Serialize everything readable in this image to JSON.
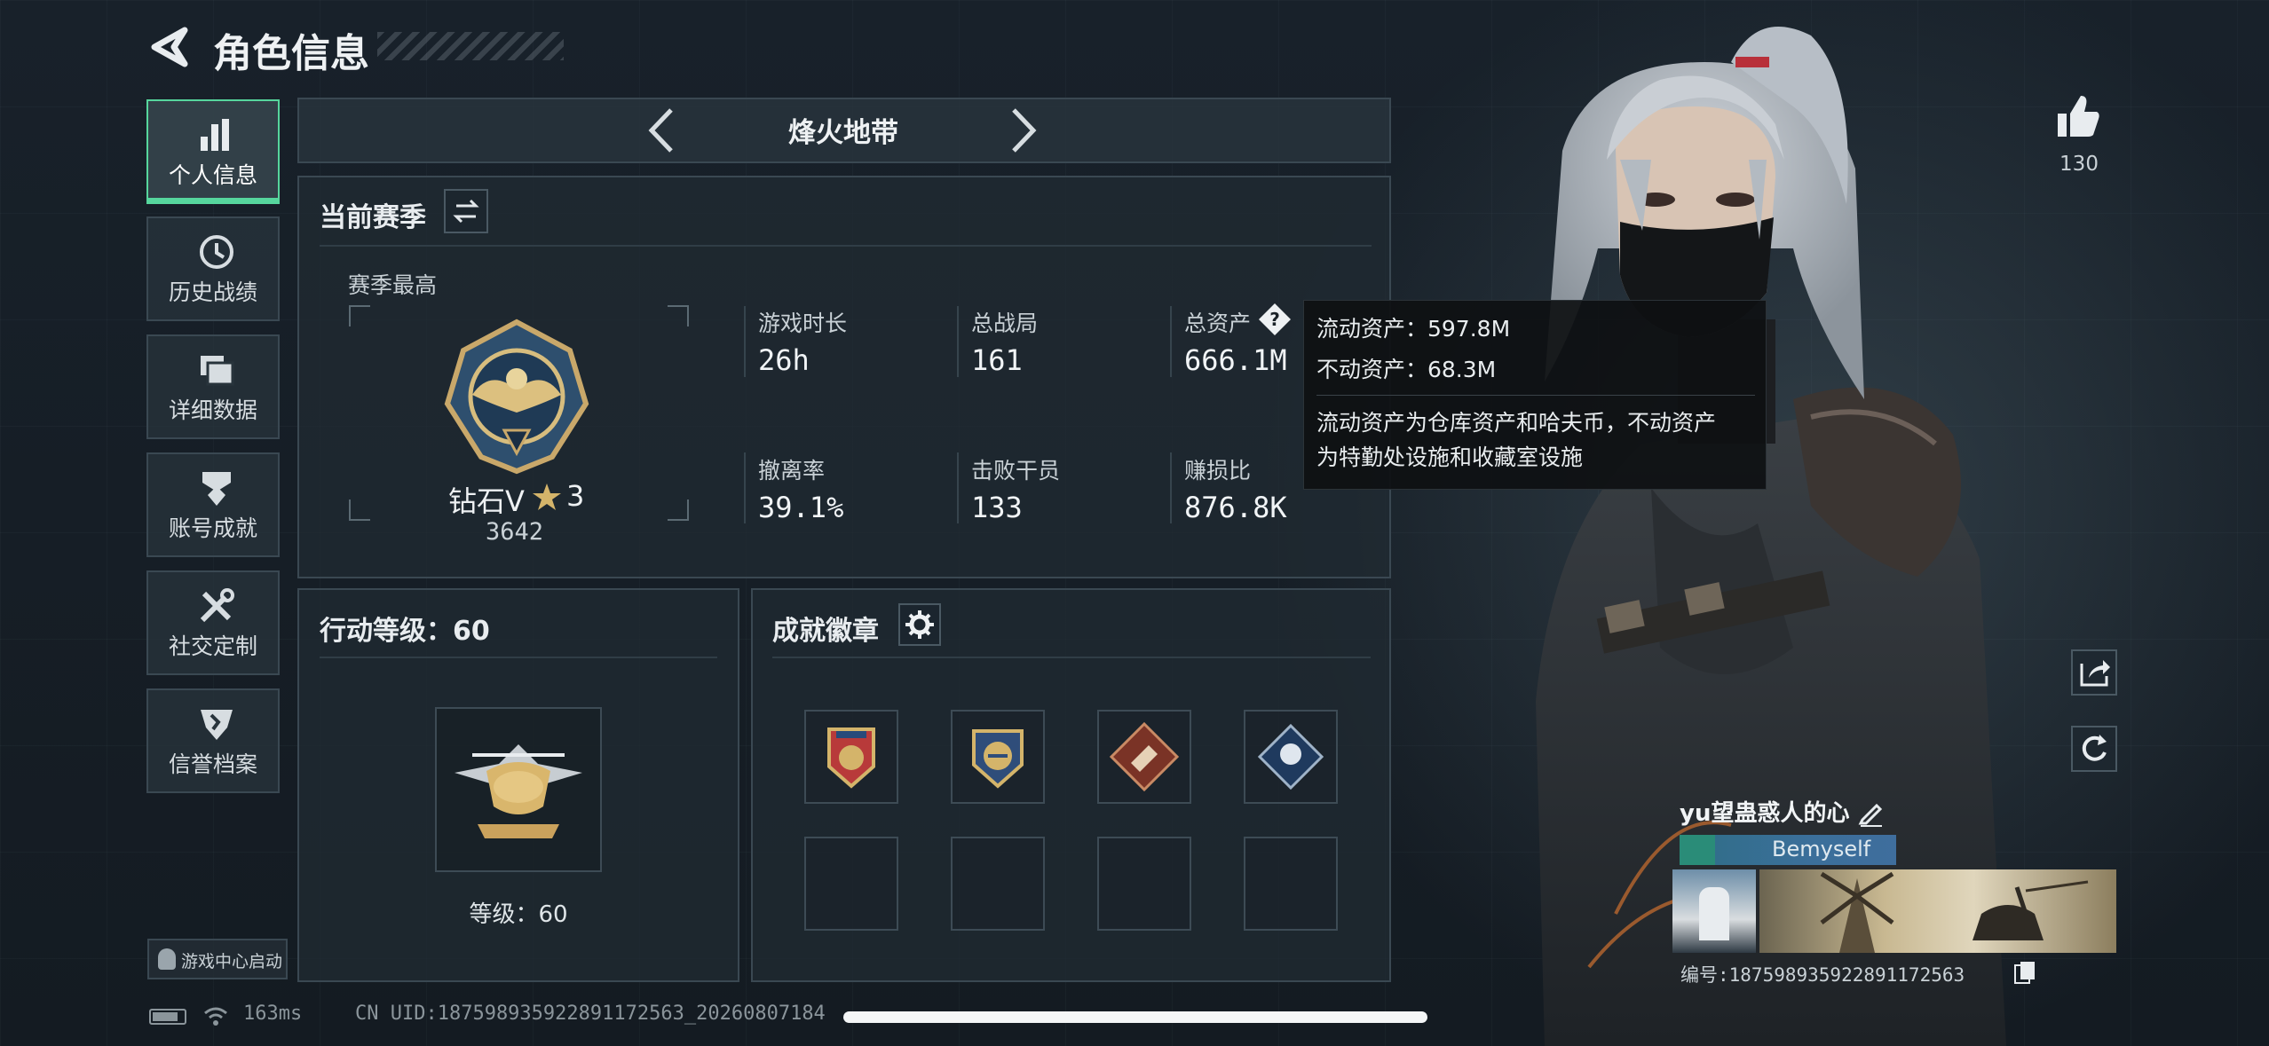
{
  "header": {
    "title": "角色信息"
  },
  "sidebar": {
    "items": [
      {
        "label": "个人信息",
        "icon": "bar-chart-icon",
        "active": true
      },
      {
        "label": "历史战绩",
        "icon": "clock-icon"
      },
      {
        "label": "详细数据",
        "icon": "folder-icon"
      },
      {
        "label": "账号成就",
        "icon": "achievement-icon"
      },
      {
        "label": "社交定制",
        "icon": "tools-icon"
      },
      {
        "label": "信誉档案",
        "icon": "shield-icon"
      }
    ],
    "game_center_label": "游戏中心启动"
  },
  "mode_selector": {
    "label": "烽火地带"
  },
  "season": {
    "title": "当前赛季",
    "best_label": "赛季最高",
    "rank_name": "钻石V",
    "rank_stars": "3",
    "rank_score": "3642",
    "stats": [
      {
        "label": "游戏时长",
        "value": "26h"
      },
      {
        "label": "总战局",
        "value": "161"
      },
      {
        "label": "总资产",
        "value": "666.1M"
      },
      {
        "label": "撤离率",
        "value": "39.1%"
      },
      {
        "label": "击败干员",
        "value": "133"
      },
      {
        "label": "赚损比",
        "value": "876.8K"
      }
    ]
  },
  "tooltip": {
    "liquid": "流动资产：597.8M",
    "fixed": "不动资产：68.3M",
    "desc_line1": "流动资产为仓库资产和哈夫币，不动资产",
    "desc_line2": "为特勤处设施和收藏室设施"
  },
  "action_level": {
    "title": "行动等级：60",
    "level_text": "等级：60"
  },
  "badges": {
    "title": "成就徽章"
  },
  "right": {
    "likes": "130",
    "player_name": "yu望蛊惑人的心",
    "tag": "Bemyself",
    "id_text": "编号:1875989359228911725​63"
  },
  "status_bar": {
    "ping": "163ms",
    "uid": "CN UID:187598935922891172563_20260807184"
  },
  "colors": {
    "accent": "#56d69d",
    "gold": "#d4b46a",
    "panel": "#202a32"
  }
}
